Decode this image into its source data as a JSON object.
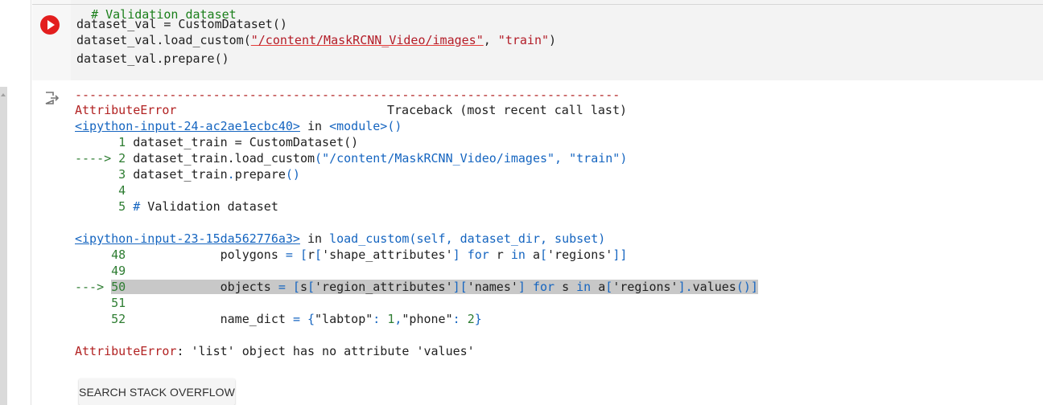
{
  "code_cell": {
    "run_button_label": "Run cell",
    "lines": [
      {
        "comment": "# Validation dataset"
      },
      {
        "text": "dataset_val = CustomDataset()"
      },
      {
        "pre": "dataset_val.load_custom(",
        "str1": "\"/content/MaskRCNN_Video/images\"",
        "mid": ", ",
        "str2": "\"train\"",
        "post": ")"
      },
      {
        "text": "dataset_val.prepare()"
      }
    ]
  },
  "output": {
    "icon": "output-redirect-icon",
    "separator": "---------------------------------------------------------------------------",
    "error_name": "AttributeError",
    "traceback_label": "Traceback (most recent call last)",
    "frame1": {
      "link": "<ipython-input-24-ac2ae1ecbc40>",
      "in_word": " in ",
      "location": "<module>()",
      "lines": [
        {
          "prefix": "      1 ",
          "code": "dataset_train = CustomDataset()"
        },
        {
          "prefix": "----> 2 ",
          "code": "dataset_train.load_custom(\"/content/MaskRCNN_Video/images\", \"train\")"
        },
        {
          "prefix": "      3 ",
          "code": "dataset_train.prepare()"
        },
        {
          "prefix": "      4",
          "code": ""
        },
        {
          "prefix": "      5 ",
          "code": "# Validation dataset"
        }
      ]
    },
    "frame2": {
      "link": "<ipython-input-23-15da562776a3>",
      "in_word": " in ",
      "location": "load_custom(self, dataset_dir, subset)",
      "lines": [
        {
          "prefix": "     48",
          "code": "             polygons = [r['shape_attributes'] for r in a['regions']]"
        },
        {
          "prefix": "     49",
          "code": ""
        },
        {
          "prefix": "---> ",
          "num": "50",
          "code": "             objects = [s['region_attributes']['names'] for s in a['regions'].values()]"
        },
        {
          "prefix": "     51",
          "code": ""
        },
        {
          "prefix": "     52",
          "code": "             name_dict = {\"labtop\": 1,\"phone\": 2}"
        }
      ]
    },
    "final_error_name": "AttributeError",
    "final_error_message": ": 'list' object has no attribute 'values'"
  },
  "search_button_label": "SEARCH STACK OVERFLOW"
}
